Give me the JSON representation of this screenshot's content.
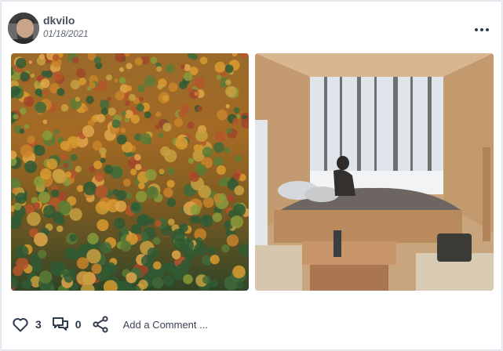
{
  "post": {
    "username": "dkvilo",
    "date": "01/18/2021",
    "menu_icon": "more-horizontal-icon"
  },
  "images": [
    {
      "subject": "autumn forest aerial",
      "icon": "image"
    },
    {
      "subject": "cabin window snowy woods",
      "icon": "image"
    }
  ],
  "actions": {
    "likes": "3",
    "comments": "0",
    "add_comment": "Add a Comment ...",
    "like_icon": "heart-icon",
    "comment_icon": "comments-icon",
    "share_icon": "share-icon"
  },
  "colors": {
    "text_primary": "#2f3a4c",
    "icon": "#2f3a4c",
    "background": "#e9edf2",
    "card": "#ffffff"
  }
}
